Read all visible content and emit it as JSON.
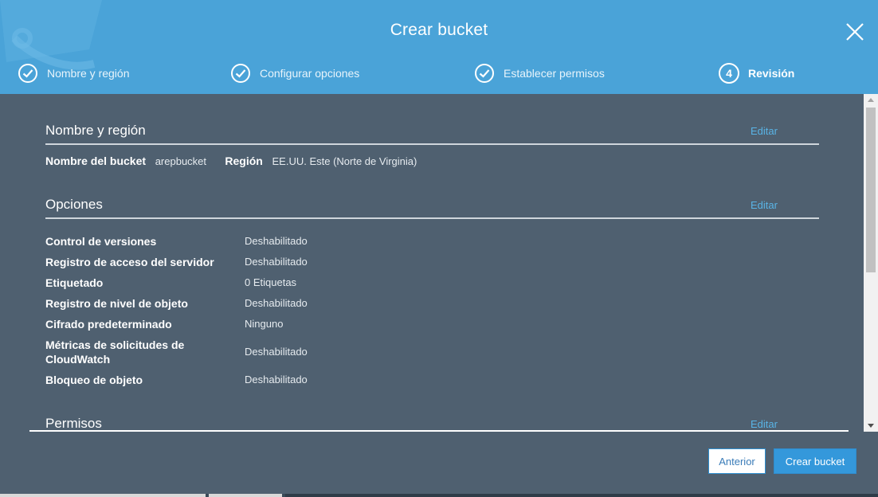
{
  "dialog": {
    "title": "Crear bucket",
    "close_icon": "close-icon"
  },
  "steps": [
    {
      "label": "Nombre y región",
      "state": "done",
      "icon": "check-circle-icon"
    },
    {
      "label": "Configurar opciones",
      "state": "done",
      "icon": "check-circle-icon"
    },
    {
      "label": "Establecer permisos",
      "state": "done",
      "icon": "check-circle-icon"
    },
    {
      "label": "Revisión",
      "state": "active",
      "number": "4"
    }
  ],
  "sections": {
    "name_region": {
      "title": "Nombre y región",
      "edit": "Editar",
      "bucket_label": "Nombre del bucket",
      "bucket_value": "arepbucket",
      "region_label": "Región",
      "region_value": "EE.UU. Este (Norte de Virginia)"
    },
    "options": {
      "title": "Opciones",
      "edit": "Editar",
      "rows": [
        {
          "label": "Control de versiones",
          "value": "Deshabilitado"
        },
        {
          "label": "Registro de acceso del servidor",
          "value": "Deshabilitado"
        },
        {
          "label": "Etiquetado",
          "value": "0 Etiquetas"
        },
        {
          "label": "Registro de nivel de objeto",
          "value": "Deshabilitado"
        },
        {
          "label": "Cifrado predeterminado",
          "value": "Ninguno"
        },
        {
          "label": "Métricas de solicitudes de CloudWatch",
          "value": "Deshabilitado"
        },
        {
          "label": "Bloqueo de objeto",
          "value": "Deshabilitado"
        }
      ]
    },
    "permissions": {
      "title": "Permisos",
      "edit": "Editar"
    }
  },
  "footer": {
    "prev_label": "Anterior",
    "create_label": "Crear bucket"
  },
  "colors": {
    "header": "#4aa3d8",
    "body": "#4f6070",
    "link": "#59b4e6",
    "primary_button": "#3498db"
  }
}
